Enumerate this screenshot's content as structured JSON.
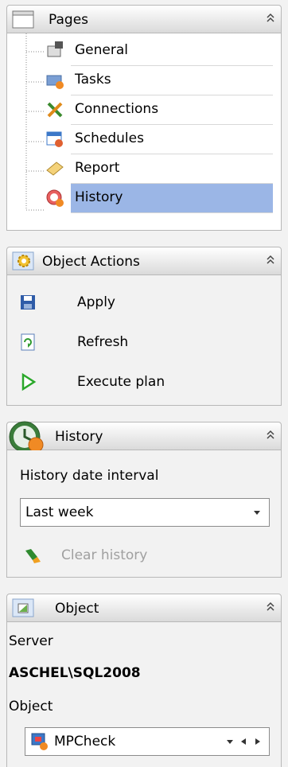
{
  "pages_panel": {
    "title": "Pages",
    "items": [
      {
        "label": "General",
        "icon": "general-page-icon"
      },
      {
        "label": "Tasks",
        "icon": "tasks-page-icon"
      },
      {
        "label": "Connections",
        "icon": "connections-page-icon"
      },
      {
        "label": "Schedules",
        "icon": "schedules-page-icon"
      },
      {
        "label": "Report",
        "icon": "report-page-icon"
      },
      {
        "label": "History",
        "icon": "history-page-icon",
        "selected": true
      }
    ]
  },
  "actions_panel": {
    "title": "Object Actions",
    "items": [
      {
        "label": "Apply",
        "icon": "save-icon"
      },
      {
        "label": "Refresh",
        "icon": "refresh-icon"
      },
      {
        "label": "Execute plan",
        "icon": "play-icon"
      }
    ]
  },
  "history_panel": {
    "title": "History",
    "interval_label": "History date interval",
    "interval_value": "Last week",
    "clear_label": "Clear history"
  },
  "object_panel": {
    "title": "Object",
    "server_label": "Server",
    "server_value": "ASCHEL\\SQL2008",
    "object_label": "Object",
    "object_value": "MPCheck"
  },
  "colors": {
    "selection": "#9bb6e6",
    "disabled_text": "#a0a0a0",
    "background": "#f2f2f2"
  }
}
